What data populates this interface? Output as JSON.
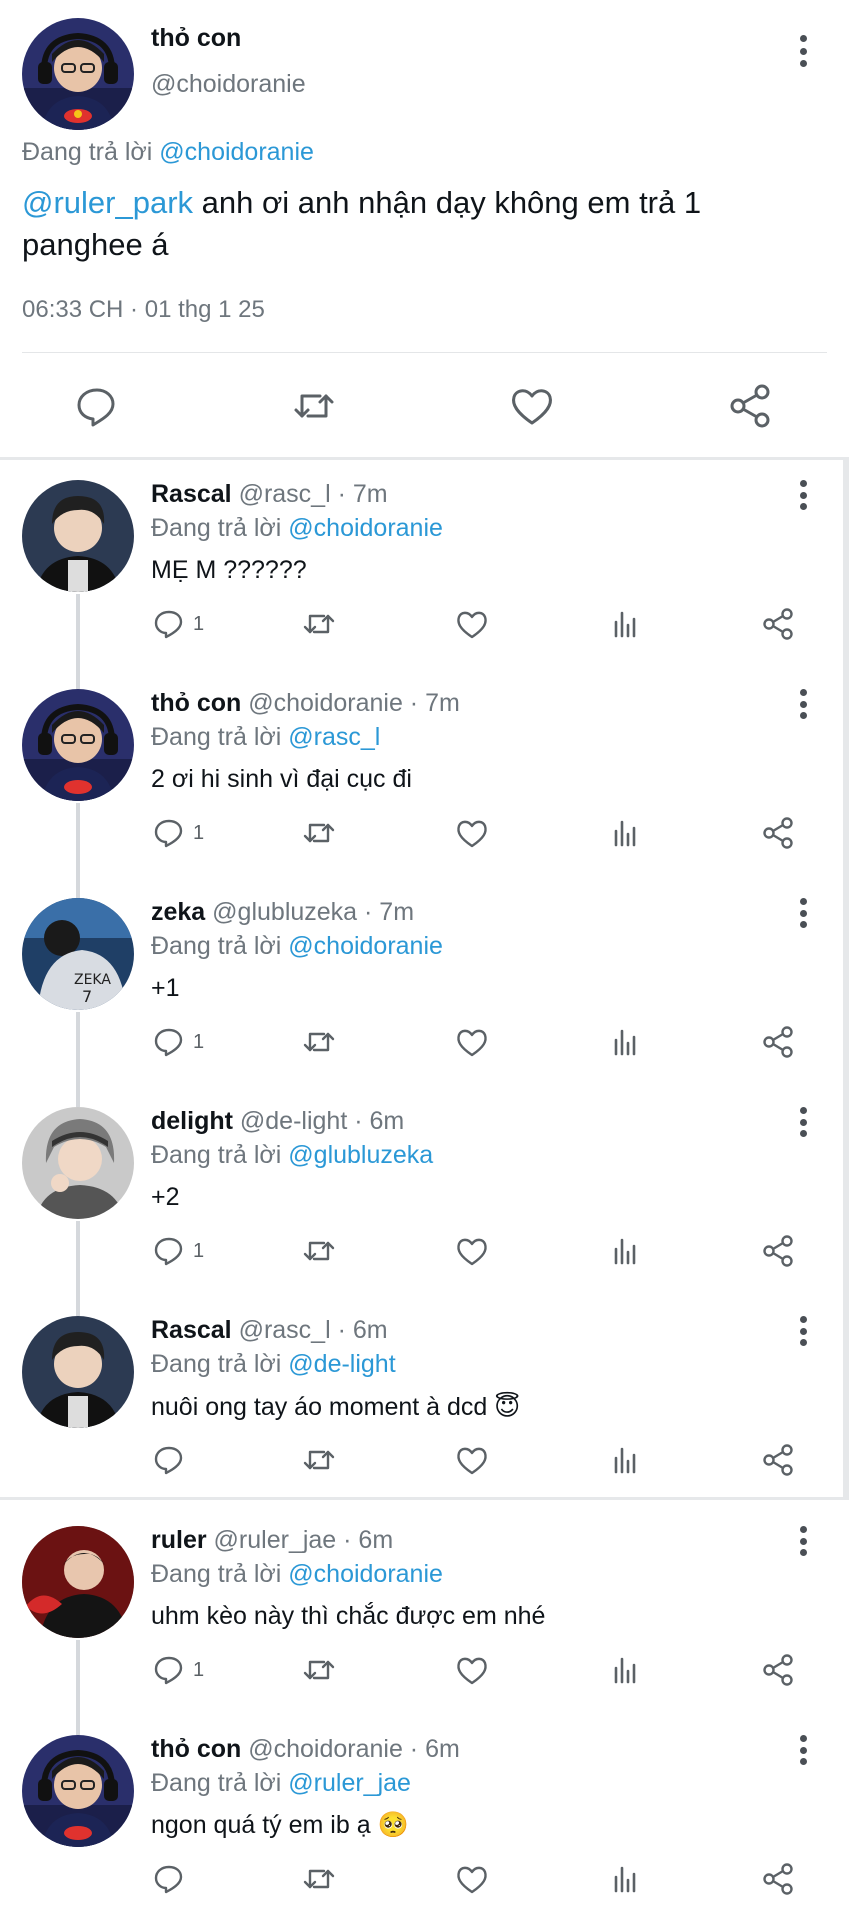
{
  "main_tweet": {
    "name": "thỏ con",
    "handle": "@choidoranie",
    "replying_prefix": "Đang trả lời ",
    "replying_to": "@choidoranie",
    "mention": "@ruler_park",
    "text": " anh ơi anh nhận dạy không em trả 1 panghee á",
    "timestamp": "06:33 CH · 01 thg 1 25",
    "avatar_icon": "avatar-headphones-redbull"
  },
  "action_icons": [
    "reply-icon",
    "retweet-icon",
    "like-icon",
    "share-icon"
  ],
  "replies": [
    {
      "name": "Rascal",
      "handle": "@rasc_l · 7m",
      "replying_prefix": "Đang trả lời ",
      "replying_to": "@choidoranie",
      "text": "MẸ M ??????",
      "reply_count": "1",
      "avatar": "rascal"
    },
    {
      "name": "thỏ con",
      "handle": " @choidoranie · 7m",
      "replying_prefix": "Đang trả lời ",
      "replying_to": "@rasc_l",
      "text": "2 ơi hi sinh vì đại cục đi",
      "reply_count": "1",
      "avatar": "tho"
    },
    {
      "name": "zeka",
      "handle": "@glubluzeka · 7m",
      "replying_prefix": "Đang trả lời ",
      "replying_to": "@choidoranie",
      "text": "+1",
      "reply_count": "1",
      "avatar": "zeka"
    },
    {
      "name": "delight",
      "handle": " @de-light · 6m",
      "replying_prefix": "Đang trả lời ",
      "replying_to": "@glubluzeka",
      "text": "+2",
      "reply_count": "1",
      "avatar": "delight"
    },
    {
      "name": "Rascal",
      "handle": "@rasc_l · 6m",
      "replying_prefix": "Đang trả lời ",
      "replying_to": "@de-light",
      "text": "nuôi ong tay áo moment à dcd 😇",
      "reply_count": "",
      "avatar": "rascal"
    },
    {
      "name": "ruler",
      "handle": "@ruler_jae · 6m",
      "replying_prefix": "Đang trả lời ",
      "replying_to": "@choidoranie",
      "text": "uhm kèo này thì chắc được em nhé",
      "reply_count": "1",
      "avatar": "ruler"
    },
    {
      "name": "thỏ con",
      "handle": " @choidoranie · 6m",
      "replying_prefix": "Đang trả lời ",
      "replying_to": "@ruler_jae",
      "text": "ngon quá tý em ib ạ 🥺",
      "reply_count": "",
      "avatar": "tho"
    }
  ],
  "colors": {
    "link": "#2b98d6",
    "muted": "#6e767d",
    "text": "#0f1419",
    "icon": "#5b6166"
  }
}
